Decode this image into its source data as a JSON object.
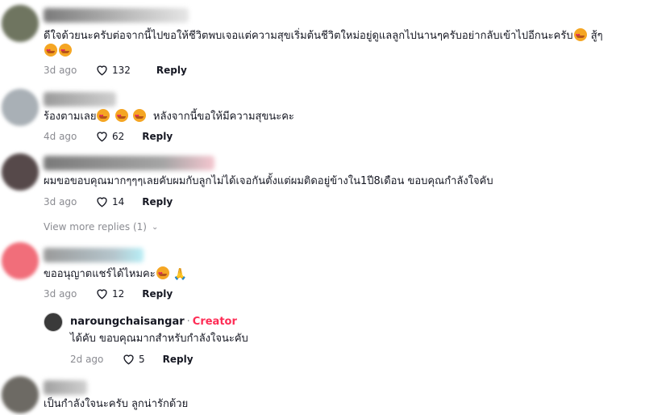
{
  "comments": [
    {
      "text": "ดีใจด้วยนะครับต่อจากนี้ไปขอให้ชีวิตพบเจอแต่ความสุขเริ่มต้นชีวิตใหม่อยู่ดูแลลูกไปนานๆครับอย่ากลับเข้าไปอีกนะครับ",
      "text_tail": "สู้ๆ",
      "time": "3d ago",
      "likes": "132",
      "reply": "Reply"
    },
    {
      "text_pre": "ร้องตามเลย",
      "text": "หลังจากนี้ขอให้มีความสุขนะคะ",
      "time": "4d ago",
      "likes": "62",
      "reply": "Reply"
    },
    {
      "text": "ผมขอขอบคุณมากๆๆๆเลยคับผมกับลูกไม่ได้เจอกันตั้งแต่ผมติดอยู่ข้างใน1ปี8เดือน ขอบคุณกำลังใจคับ",
      "time": "3d ago",
      "likes": "14",
      "reply": "Reply",
      "view_more": "View more replies (1)"
    },
    {
      "text": "ขออนุญาตแชร์ได้ไหมคะ",
      "time": "3d ago",
      "likes": "12",
      "reply": "Reply"
    },
    {
      "text": "เป็นกำลังใจนะครับ ลูกน่ารักด้วย"
    }
  ],
  "creator_reply": {
    "username": "naroungchaisangar",
    "separator": "·",
    "badge": "Creator",
    "text": "ได้คับ ขอบคุณมากสำหรับกำลังใจนะคับ",
    "time": "2d ago",
    "likes": "5",
    "reply": "Reply"
  },
  "icons": {
    "like": "heart-outline-icon",
    "chevron": "chevron-down-icon",
    "emoji": "smiling-face-with-hearts-emoji",
    "pray": "folded-hands-emoji"
  },
  "colors": {
    "creator_badge": "#fe2c55",
    "meta": "#8a8b91",
    "text": "#161823"
  }
}
